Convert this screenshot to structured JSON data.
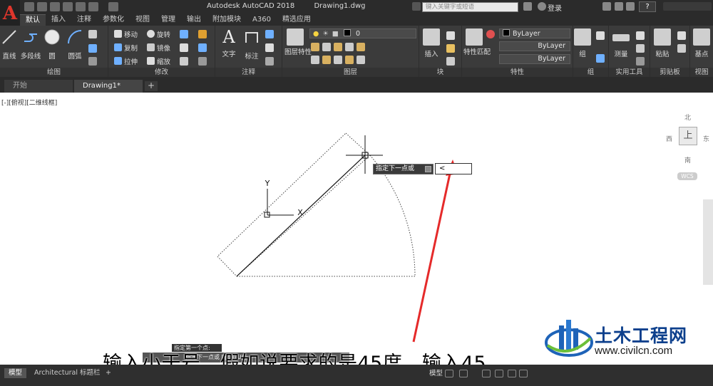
{
  "title_bar": {
    "app_name": "Autodesk AutoCAD 2018",
    "document": "Drawing1.dwg",
    "search_placeholder": "键入关键字或短语",
    "login": "登录",
    "help": "?"
  },
  "app_logo": "A",
  "ribbon_tabs": [
    "默认",
    "插入",
    "注释",
    "参数化",
    "视图",
    "管理",
    "输出",
    "附加模块",
    "A360",
    "精选应用"
  ],
  "ribbon": {
    "draw": {
      "title": "绘图",
      "line": "直线",
      "polyline": "多段线",
      "circle": "圆",
      "arc": "圆弧"
    },
    "modify": {
      "title": "修改",
      "move": "移动",
      "rotate": "旋转",
      "copy": "复制",
      "mirror": "镜像",
      "stretch": "拉伸",
      "scale": "缩放"
    },
    "annotation": {
      "title": "注释",
      "text": "文字",
      "dimension": "标注"
    },
    "layers": {
      "title": "图层",
      "layer_properties": "图层特性",
      "current_layer": "0"
    },
    "block": {
      "title": "块",
      "insert": "插入"
    },
    "properties": {
      "title": "特性",
      "match": "特性匹配",
      "color": "ByLayer",
      "linetype": "ByLayer",
      "lineweight": "ByLayer"
    },
    "groups": {
      "title": "组",
      "group": "组"
    },
    "utilities": {
      "title": "实用工具",
      "measure": "测量"
    },
    "clipboard": {
      "title": "剪贴板",
      "paste": "粘贴"
    },
    "view": {
      "title": "视图",
      "base": "基点"
    }
  },
  "document_tabs": {
    "start": "开始",
    "drawing": "Drawing1*",
    "add": "+"
  },
  "viewport_label": "[-][俯视][二维线框]",
  "drawing": {
    "ucs_y": "Y",
    "ucs_x": "X"
  },
  "viewcube": {
    "north": "北",
    "south": "南",
    "east": "东",
    "west": "西",
    "top_face": "上",
    "wcs": "WCS"
  },
  "dynamic_input": {
    "prompt": "指定下一点或",
    "value": "<"
  },
  "command_history": {
    "previous": "指定第一个点:",
    "current": "指定下一点或 [放弃(U)]:"
  },
  "caption": "输入小于号，假如说要求的是45度，输入45",
  "watermark": {
    "name": "土木工程网",
    "url": "www.civilcn.com"
  },
  "status_bar": {
    "model_tab": "模型",
    "layout_tab": "Architectural 标题栏",
    "add": "+",
    "model_button": "模型"
  }
}
